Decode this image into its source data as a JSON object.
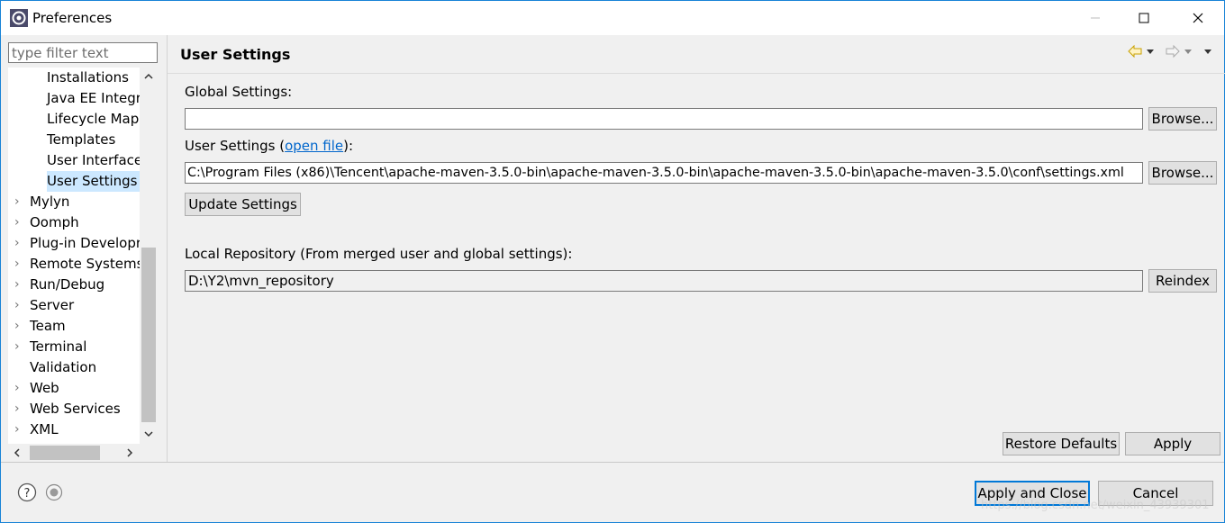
{
  "window": {
    "title": "Preferences"
  },
  "filter": {
    "placeholder": "type filter text"
  },
  "tree": {
    "items": [
      {
        "label": "Installations",
        "expandable": false
      },
      {
        "label": "Java EE Integra",
        "expandable": false
      },
      {
        "label": "Lifecycle Mapp",
        "expandable": false
      },
      {
        "label": "Templates",
        "expandable": false
      },
      {
        "label": "User Interface",
        "expandable": false
      },
      {
        "label": "User Settings",
        "expandable": false,
        "selected": true
      },
      {
        "label": "Mylyn",
        "expandable": true
      },
      {
        "label": "Oomph",
        "expandable": true
      },
      {
        "label": "Plug-in Developr",
        "expandable": true
      },
      {
        "label": "Remote Systems",
        "expandable": true
      },
      {
        "label": "Run/Debug",
        "expandable": true
      },
      {
        "label": "Server",
        "expandable": true
      },
      {
        "label": "Team",
        "expandable": true
      },
      {
        "label": "Terminal",
        "expandable": true
      },
      {
        "label": "Validation",
        "expandable": false
      },
      {
        "label": "Web",
        "expandable": true
      },
      {
        "label": "Web Services",
        "expandable": true
      },
      {
        "label": "XML",
        "expandable": true
      }
    ]
  },
  "page": {
    "title": "User Settings",
    "global_settings_label": "Global Settings:",
    "global_settings_value": "",
    "user_settings_label_prefix": "User Settings (",
    "user_settings_link": "open file",
    "user_settings_label_suffix": "):",
    "user_settings_value": "C:\\Program Files (x86)\\Tencent\\apache-maven-3.5.0-bin\\apache-maven-3.5.0-bin\\apache-maven-3.5.0-bin\\apache-maven-3.5.0\\conf\\settings.xml",
    "browse_label": "Browse...",
    "update_settings_label": "Update Settings",
    "local_repo_label": "Local Repository (From merged user and global settings):",
    "local_repo_value": "D:\\Y2\\mvn_repository",
    "reindex_label": "Reindex",
    "restore_defaults_label": "Restore Defaults",
    "apply_label": "Apply"
  },
  "footer": {
    "apply_close_label": "Apply and Close",
    "cancel_label": "Cancel",
    "watermark": "https://blog.csdn.net/weixin_43939301"
  }
}
